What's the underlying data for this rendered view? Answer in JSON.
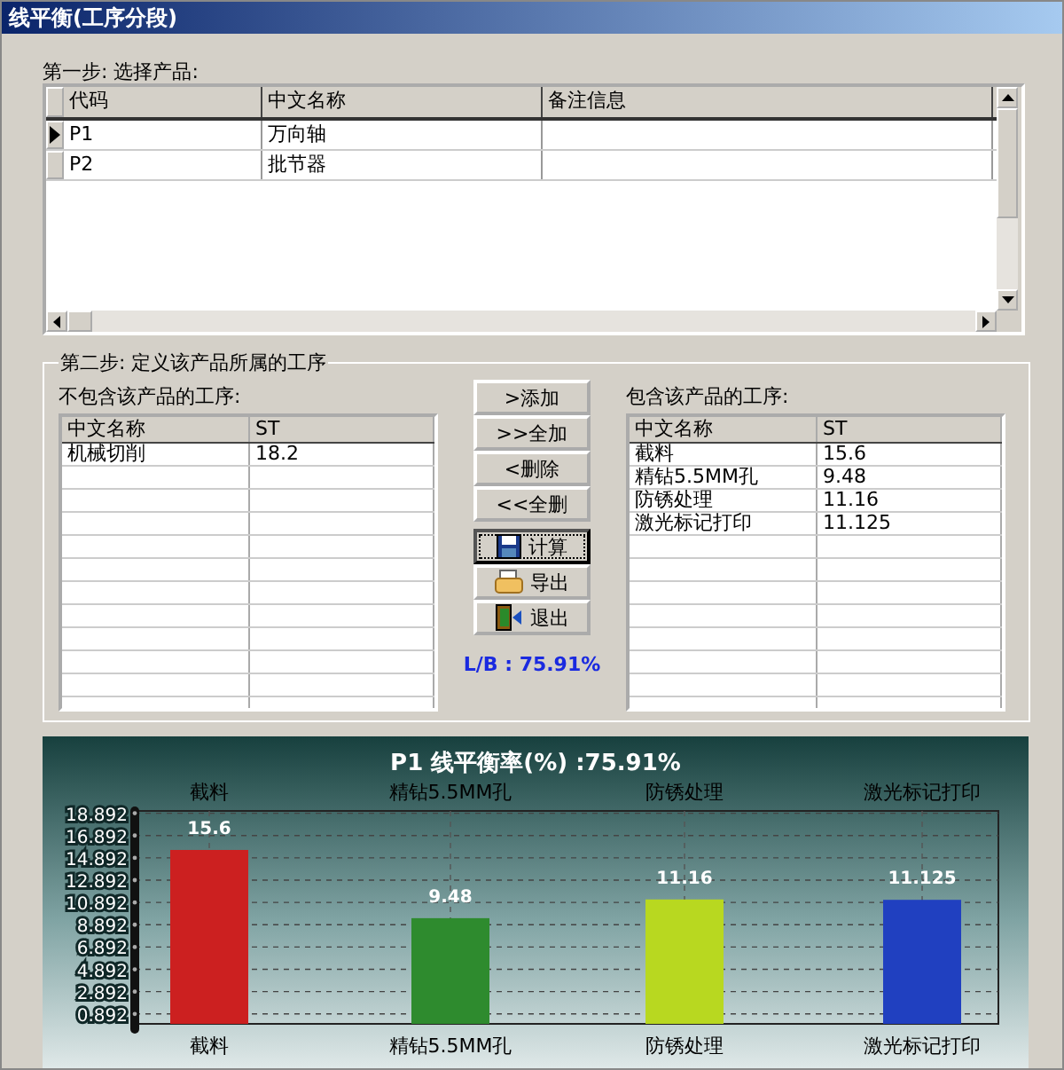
{
  "window": {
    "title": "线平衡(工序分段)"
  },
  "step1": {
    "label": "第一步: 选择产品:",
    "columns": [
      "代码",
      "中文名称",
      "备注信息"
    ],
    "rows": [
      {
        "cells": [
          "P1",
          "万向轴",
          ""
        ],
        "selected": true
      },
      {
        "cells": [
          "P2",
          "批节器",
          ""
        ],
        "selected": false
      }
    ]
  },
  "step2": {
    "label": "第二步: 定义该产品所属的工序",
    "excluded": {
      "label": "不包含该产品的工序:",
      "columns": [
        "中文名称",
        "ST"
      ],
      "rows": [
        [
          "机械切削",
          "18.2"
        ]
      ]
    },
    "included": {
      "label": "包含该产品的工序:",
      "columns": [
        "中文名称",
        "ST"
      ],
      "rows": [
        [
          "截料",
          "15.6"
        ],
        [
          "精钻5.5MM孔",
          "9.48"
        ],
        [
          "防锈处理",
          "11.16"
        ],
        [
          "激光标记打印",
          "11.125"
        ]
      ]
    },
    "move_buttons": [
      ">添加",
      ">>全加",
      "<删除",
      "<<全删"
    ],
    "action_buttons": [
      {
        "label": "计算",
        "kind": "save",
        "focused": true
      },
      {
        "label": "导出",
        "kind": "export",
        "focused": false
      },
      {
        "label": "退出",
        "kind": "exit",
        "focused": false
      }
    ],
    "result": "L/B : 75.91%"
  },
  "chart": {
    "chart_data": {
      "type": "bar",
      "title": "P1 线平衡率(%) :75.91%",
      "categories": [
        "截料",
        "精钻5.5MM孔",
        "防锈处理",
        "激光标记打印"
      ],
      "series": [
        {
          "color": "#cc2020",
          "values": [
            15.6,
            null,
            null,
            null
          ]
        },
        {
          "color": "#2e8b2e",
          "values": [
            null,
            9.48,
            null,
            null
          ]
        },
        {
          "color": "#b8d820",
          "values": [
            null,
            null,
            11.16,
            null
          ]
        },
        {
          "color": "#2040c0",
          "values": [
            null,
            null,
            null,
            11.125
          ]
        }
      ],
      "grid": true,
      "ylim": [
        0,
        19.1
      ],
      "yticks": [
        0.892,
        2.892,
        4.892,
        6.892,
        8.892,
        10.892,
        12.892,
        14.892,
        16.892,
        18.892
      ],
      "data_labels": true
    }
  }
}
